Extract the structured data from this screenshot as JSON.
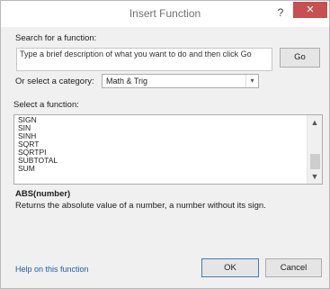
{
  "window": {
    "title": "Insert Function",
    "help_label": "?",
    "close_label": "✕"
  },
  "search": {
    "label": "Search for a function:",
    "value": "Type a brief description of what you want to do and then click Go",
    "go_label": "Go"
  },
  "category": {
    "label": "Or select a category:",
    "selected": "Math & Trig",
    "arrow": "▾"
  },
  "functions": {
    "label": "Select a function:",
    "items": [
      "SIGN",
      "SIN",
      "SINH",
      "SQRT",
      "SQRTPI",
      "SUBTOTAL",
      "SUM"
    ],
    "scroll_up": "▲",
    "scroll_down": "▼"
  },
  "details": {
    "syntax": "ABS(number)",
    "description": "Returns the absolute value of a number, a number without its sign."
  },
  "footer": {
    "help_link": "Help on this function",
    "ok_label": "OK",
    "cancel_label": "Cancel"
  },
  "colors": {
    "close_button": "#c75050",
    "dialog_bg": "#f0f0f0",
    "link": "#1b5fb3"
  }
}
